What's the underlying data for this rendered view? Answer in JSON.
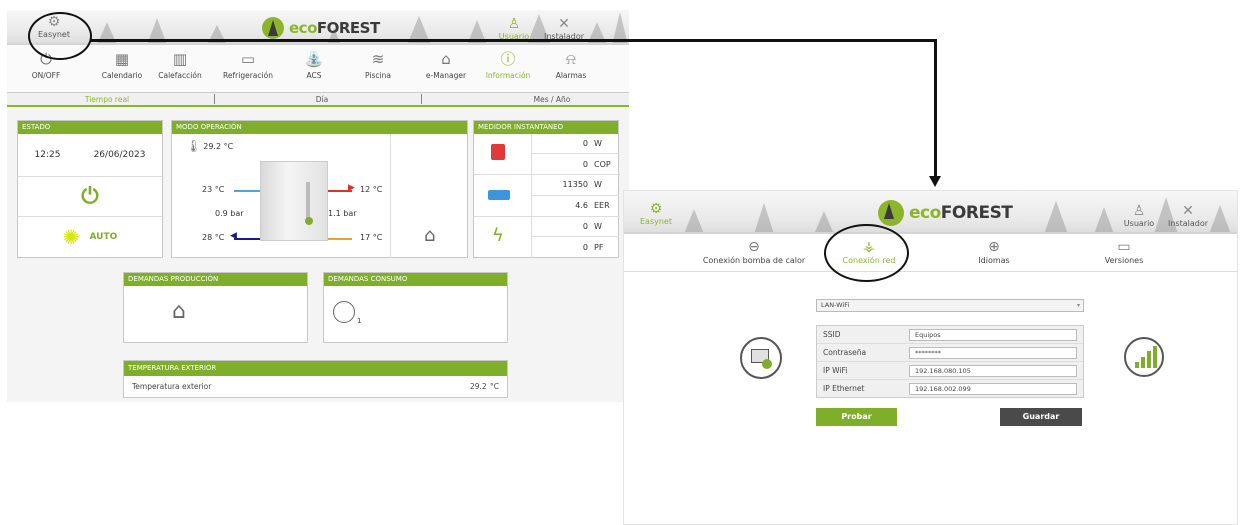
{
  "brand": {
    "name_prefix": "eco",
    "name_suffix": "FOREST"
  },
  "left": {
    "header": {
      "easynet": "Easynet",
      "usuario": "Usuario",
      "instalador": "Instalador"
    },
    "menu": [
      "ON/OFF",
      "Calendario",
      "Calefacción",
      "Refrigeración",
      "ACS",
      "Piscina",
      "e-Manager",
      "Información",
      "Alarmas"
    ],
    "active_menu": "Información",
    "subtabs": [
      "Tiempo real",
      "Día",
      "Mes / Año"
    ],
    "estado": {
      "title": "ESTADO",
      "time": "12:25",
      "date": "26/06/2023",
      "mode": "AUTO"
    },
    "modo": {
      "title": "MODO OPERACIÓN",
      "temp_top": "29.2 °C",
      "left_top": "23 °C",
      "left_pressure": "0.9 bar",
      "left_bottom": "28 °C",
      "right_top": "12 °C",
      "right_pressure": "1.1 bar",
      "right_bottom": "17 °C"
    },
    "medidor": {
      "title": "MEDIDOR INSTANTÁNEO",
      "rows": [
        {
          "v1": "0",
          "u1": "W",
          "v2": "0",
          "u2": "COP"
        },
        {
          "v1": "11350",
          "u1": "W",
          "v2": "4.6",
          "u2": "EER"
        },
        {
          "v1": "0",
          "u1": "W",
          "v2": "0",
          "u2": "PF"
        }
      ]
    },
    "dem_prod": {
      "title": "DEMANDAS PRODUCCIÓN"
    },
    "dem_cons": {
      "title": "DEMANDAS CONSUMO",
      "count": "1"
    },
    "temp_ext": {
      "title": "TEMPERATURA EXTERIOR",
      "label": "Temperatura exterior",
      "value": "29.2",
      "unit": "°C"
    }
  },
  "right": {
    "header": {
      "easynet": "Easynet",
      "usuario": "Usuario",
      "instalador": "Instalador"
    },
    "tabs": [
      "Conexión bomba de calor",
      "Conexión red",
      "Idiomas",
      "Versiones"
    ],
    "active_tab": "Conexión red",
    "select_value": "LAN-WiFi",
    "fields": [
      {
        "label": "SSID",
        "value": "Equipos"
      },
      {
        "label": "Contraseña",
        "value": "********"
      },
      {
        "label": "IP WiFi",
        "value": "192.168.080.105"
      },
      {
        "label": "IP Ethernet",
        "value": "192.168.002.099"
      }
    ],
    "btn_probar": "Probar",
    "btn_guardar": "Guardar"
  },
  "colors": {
    "accent": "#8db52c",
    "title_bar": "#7eae2a",
    "dark_button": "#4a4a4a"
  },
  "icons": [
    "gear-icon",
    "user-icon",
    "tools-icon",
    "power-icon",
    "calendar-icon",
    "radiator-icon",
    "ac-icon",
    "shower-icon",
    "pool-icon",
    "house-icon",
    "info-icon",
    "bell-icon",
    "sun-icon",
    "thermometer-icon",
    "heatpump-icon",
    "lightning-icon",
    "globe-icon",
    "monitor-icon",
    "network-icon",
    "signal-icon"
  ]
}
